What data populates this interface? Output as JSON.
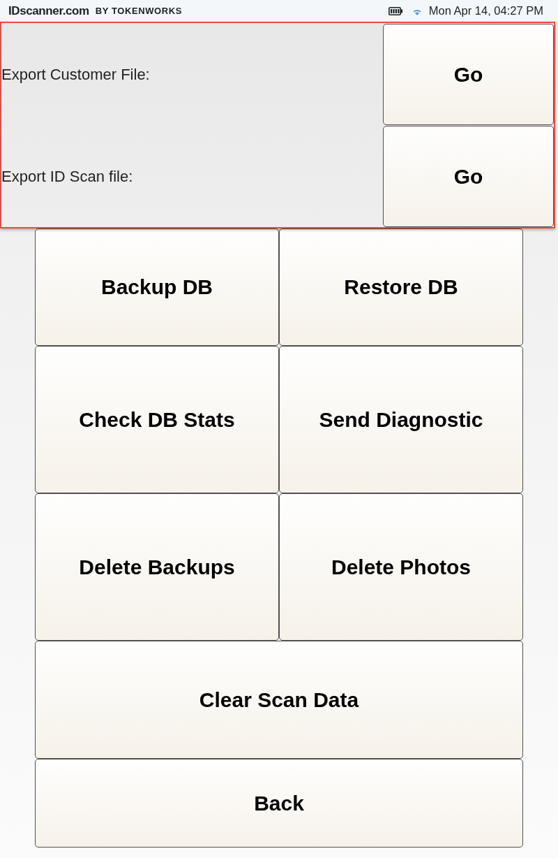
{
  "status_bar": {
    "logo": {
      "brand": "IDscanner.com",
      "byline": "BY TOKENWORKS"
    },
    "time": "Mon Apr 14, 04:27 PM"
  },
  "export_panel": {
    "rows": [
      {
        "label": "Export Customer File:",
        "button": "Go"
      },
      {
        "label": "Export ID Scan file:",
        "button": "Go"
      }
    ]
  },
  "action_rows": [
    [
      "Backup DB",
      "Restore DB"
    ],
    [
      "Check DB Stats",
      "Send Diagnostic"
    ],
    [
      "Delete Backups",
      "Delete Photos"
    ],
    [
      "Clear Scan Data"
    ],
    [
      "Back"
    ]
  ]
}
